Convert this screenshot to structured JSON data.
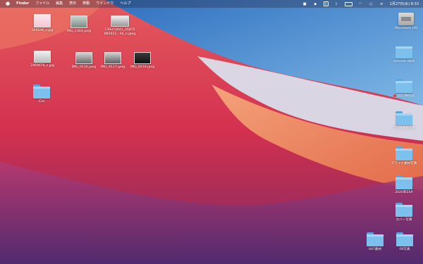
{
  "menubar": {
    "apple_icon": "apple-icon",
    "app_name": "Finder",
    "menus": [
      "ファイル",
      "編集",
      "表示",
      "移動",
      "ウインドウ",
      "ヘルプ"
    ],
    "status_icons": [
      "camera-icon",
      "dropbox-icon",
      "a-input-icon",
      "bluetooth-icon",
      "battery-icon",
      "wifi-icon",
      "search-icon",
      "control-center-icon"
    ],
    "clock": "1月27日(水) 8:33"
  },
  "desktop_left": [
    {
      "label": "169546_s.jpg"
    },
    {
      "label": "IMG_1303.jpeg"
    },
    {
      "label": "139372641_35815\n885652...46_n.jpeg"
    },
    {
      "label": "2469676_s.jpg"
    },
    {
      "label": "IMG_9116.jpeg"
    },
    {
      "label": "IMG_9117.jpeg"
    },
    {
      "label": "IMG_9119.jpeg"
    },
    {
      "label": "iCar"
    }
  ],
  "desktop_right": [
    {
      "label": "Macintosh HD"
    },
    {
      "label": "seminar data"
    },
    {
      "label": "2021年ESA",
      "tag_color": "#e04040"
    },
    {
      "label": "ブログ素材写真"
    },
    {
      "label": "スライド素材写真"
    },
    {
      "label": "2020年ESA"
    },
    {
      "label": "カバー写真"
    },
    {
      "label": "007素材"
    },
    {
      "label": "FB写真"
    }
  ]
}
